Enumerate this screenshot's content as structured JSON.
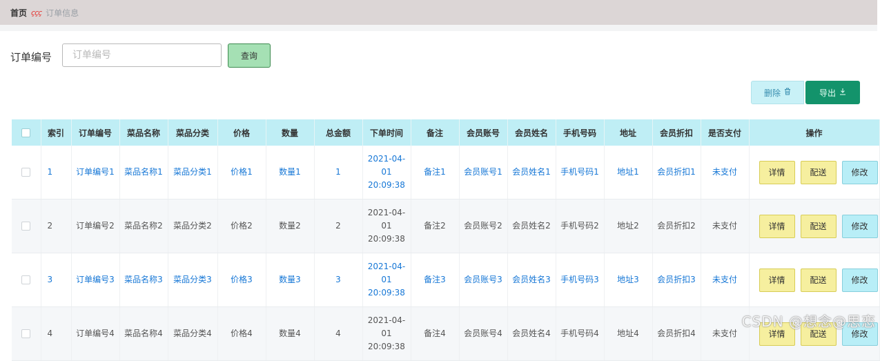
{
  "breadcrumb": {
    "home": "首页",
    "separator": "ççç",
    "current": "订单信息"
  },
  "search": {
    "label": "订单编号",
    "placeholder": "订单编号",
    "value": "",
    "button": "查询"
  },
  "actions": {
    "delete_label": "删除",
    "delete_icon": "trash-icon",
    "export_label": "导出",
    "export_icon": "download-icon"
  },
  "table": {
    "columns": [
      "",
      "索引",
      "订单编号",
      "菜品名称",
      "菜品分类",
      "价格",
      "数量",
      "总金额",
      "下单时间",
      "备注",
      "会员账号",
      "会员姓名",
      "手机号码",
      "地址",
      "会员折扣",
      "是否支付",
      "操作"
    ],
    "rows": [
      {
        "index": "1",
        "order_no": "订单编号1",
        "dish": "菜品名称1",
        "category": "菜品分类1",
        "price": "价格1",
        "qty": "数量1",
        "total": "1",
        "time": "2021-04-01 20:09:38",
        "note": "备注1",
        "account": "会员账号1",
        "name": "会员姓名1",
        "phone": "手机号码1",
        "addr": "地址1",
        "discount": "会员折扣1",
        "paid": "未支付"
      },
      {
        "index": "2",
        "order_no": "订单编号2",
        "dish": "菜品名称2",
        "category": "菜品分类2",
        "price": "价格2",
        "qty": "数量2",
        "total": "2",
        "time": "2021-04-01 20:09:38",
        "note": "备注2",
        "account": "会员账号2",
        "name": "会员姓名2",
        "phone": "手机号码2",
        "addr": "地址2",
        "discount": "会员折扣2",
        "paid": "未支付"
      },
      {
        "index": "3",
        "order_no": "订单编号3",
        "dish": "菜品名称3",
        "category": "菜品分类3",
        "price": "价格3",
        "qty": "数量3",
        "total": "3",
        "time": "2021-04-01 20:09:38",
        "note": "备注3",
        "account": "会员账号3",
        "name": "会员姓名3",
        "phone": "手机号码3",
        "addr": "地址3",
        "discount": "会员折扣3",
        "paid": "未支付"
      },
      {
        "index": "4",
        "order_no": "订单编号4",
        "dish": "菜品名称4",
        "category": "菜品分类4",
        "price": "价格4",
        "qty": "数量4",
        "total": "4",
        "time": "2021-04-01 20:09:38",
        "note": "备注4",
        "account": "会员账号4",
        "name": "会员姓名4",
        "phone": "手机号码4",
        "addr": "地址4",
        "discount": "会员折扣4",
        "paid": "未支付"
      }
    ],
    "row_buttons": {
      "detail": "详情",
      "ship": "配送",
      "edit": "修改"
    }
  },
  "watermark": "CSDN @想念@思恋",
  "colors": {
    "header_bg": "#bfeef5",
    "link_blue": "#1677d6",
    "export_green": "#13936b",
    "detail_yellow": "#f6ef9f"
  }
}
